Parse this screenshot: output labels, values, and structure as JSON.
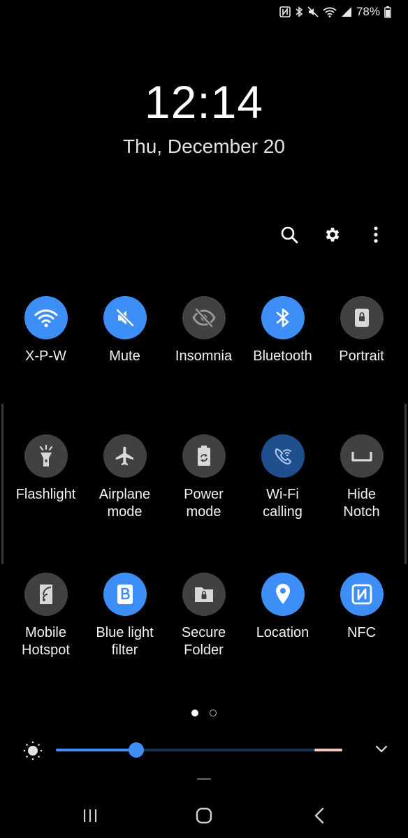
{
  "status_bar": {
    "battery_percent": "78%",
    "icons": [
      "nfc-icon",
      "bluetooth-icon",
      "mute-icon",
      "wifi-icon",
      "signal-icon",
      "battery-icon"
    ]
  },
  "lockscreen": {
    "time": "12:14",
    "date": "Thu, December 20"
  },
  "toolbar": {
    "icons": [
      "search-icon",
      "settings-gear-icon",
      "more-options-icon"
    ]
  },
  "tiles": [
    {
      "id": "wifi",
      "label": "X-P-W",
      "state": "on",
      "icon": "wifi-icon"
    },
    {
      "id": "mute",
      "label": "Mute",
      "state": "on",
      "icon": "mute-icon"
    },
    {
      "id": "insomnia",
      "label": "Insomnia",
      "state": "off",
      "icon": "eye-off-icon"
    },
    {
      "id": "bluetooth",
      "label": "Bluetooth",
      "state": "on",
      "icon": "bluetooth-icon"
    },
    {
      "id": "portrait",
      "label": "Portrait",
      "state": "off",
      "icon": "lock-rotation-icon"
    },
    {
      "id": "flashlight",
      "label": "Flashlight",
      "state": "off",
      "icon": "flashlight-icon"
    },
    {
      "id": "airplane",
      "label": "Airplane\nmode",
      "state": "off",
      "icon": "airplane-icon"
    },
    {
      "id": "power",
      "label": "Power\nmode",
      "state": "off",
      "icon": "battery-recycle-icon"
    },
    {
      "id": "wificalling",
      "label": "Wi-Fi\ncalling",
      "state": "dim",
      "icon": "wifi-calling-icon"
    },
    {
      "id": "hidenotch",
      "label": "Hide\nNotch",
      "state": "off",
      "icon": "notch-icon"
    },
    {
      "id": "hotspot",
      "label": "Mobile\nHotspot",
      "state": "off",
      "icon": "hotspot-icon"
    },
    {
      "id": "bluelight",
      "label": "Blue light\nfilter",
      "state": "on",
      "icon": "blue-light-filter-icon"
    },
    {
      "id": "securefolder",
      "label": "Secure\nFolder",
      "state": "off",
      "icon": "secure-folder-icon"
    },
    {
      "id": "location",
      "label": "Location",
      "state": "on",
      "icon": "location-pin-icon"
    },
    {
      "id": "nfc",
      "label": "NFC",
      "state": "on",
      "icon": "nfc-icon"
    }
  ],
  "pager": {
    "pages": 2,
    "current": 1
  },
  "brightness": {
    "level": 0.28,
    "icons": [
      "brightness-sun-icon",
      "chevron-down-icon"
    ]
  },
  "navigation": {
    "icons": [
      "recent-apps-icon",
      "home-icon",
      "back-icon"
    ]
  },
  "colors": {
    "accent": "#3e8ef7",
    "tile_off": "#414141",
    "tile_dim": "#1f4f8f",
    "background": "#000000"
  }
}
